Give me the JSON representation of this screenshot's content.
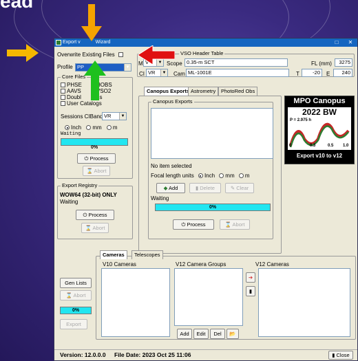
{
  "slide": {
    "title": "ead"
  },
  "window": {
    "title_left": "Export v",
    "title_right": "Wizard",
    "close_glyph": "✕",
    "min_glyph": "□"
  },
  "overwrite": {
    "label": "Overwrite Existing Files"
  },
  "profile": {
    "label": "Profile",
    "value": "PP"
  },
  "core_files": {
    "legend": "Core Files",
    "items": [
      "PHSE",
      "HOBS",
      "AAVS",
      "VSO2",
      "Doubl",
      "es",
      "User Catalogs"
    ]
  },
  "sessions": {
    "label": "Sessions CIBand",
    "value": "VR"
  },
  "units": {
    "inch": "Inch",
    "mm": "mm",
    "m": "m"
  },
  "core_status": "Waiting",
  "core_progress": "0%",
  "core_process": "Process",
  "core_abort": "Abort",
  "registry": {
    "legend": "Export Registry",
    "text": "WOW64 (32-bit) ONLY",
    "status": "Waiting",
    "process": "Process",
    "abort": "Abort"
  },
  "header_table": {
    "legend": "VSO Header Table"
  },
  "header": {
    "m_label": "M",
    "m_value": "V",
    "scope_label": "Scope",
    "scope_value": "0.35-m SCT",
    "fl_label": "FL (mm)",
    "fl_value": "3275",
    "ci_label": "CI",
    "ci_value": "VR",
    "cam_label": "Cam",
    "cam_value": "ML-1001E",
    "t_label": "T",
    "t_value": "-20",
    "e_label": "E",
    "e_value": "240"
  },
  "tabs": {
    "canopus": "Canopus Exports",
    "astrometry": "Astrometry",
    "photored": "PhotoRed Obs"
  },
  "canopus_exports": {
    "legend": "Canopus Exports",
    "no_item": "No item selected",
    "focal_label": "Focal length units",
    "inch": "Inch",
    "mm": "mm",
    "m": "m",
    "add": "Add",
    "delete": "Delete",
    "clear": "Clear",
    "status": "Waiting",
    "progress": "0%",
    "process": "Process",
    "abort": "Abort"
  },
  "logo": {
    "title": "MPO Canopus",
    "subtitle": "2022 BW",
    "period": "P = 2.975 h",
    "tick_0": "0",
    "tick_1": "0.3",
    "tick_2": "0.5",
    "tick_3": "1.0",
    "footer": "Export v10 to v12"
  },
  "bottom_tabs": {
    "cameras": "Cameras",
    "telescopes": "Telescopes"
  },
  "cameras": {
    "v10": "V10 Cameras",
    "v12_groups": "V12 Camera Groups",
    "v12": "V12 Cameras",
    "add": "Add",
    "edit": "Edit",
    "del": "Del"
  },
  "left_controls": {
    "gen_lists": "Gen Lists",
    "abort": "Abort",
    "progress": "0%",
    "export": "Export"
  },
  "status": {
    "version": "Version: 12.0.0.0",
    "file_date": "File Date: 2023 Oct 25  11:06",
    "close": "Close"
  },
  "colors": {
    "arrow_yellow": "#f5b800",
    "arrow_orange": "#f5a300",
    "arrow_red": "#e01010",
    "arrow_green": "#1ec01e",
    "progress_cyan": "#22e6f0",
    "titlebar": "#1565c0"
  }
}
